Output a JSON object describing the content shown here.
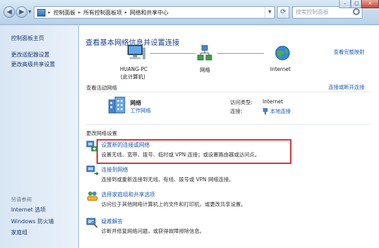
{
  "address_bar": {
    "breadcrumbs": [
      "控制面板",
      "所有控制面板项",
      "网络和共享中心"
    ],
    "search_placeholder": "搜索控制面板"
  },
  "sidebar": {
    "home": "控制面板主页",
    "links": [
      "更改适配器设置",
      "更改高级共享设置"
    ],
    "see_also_heading": "另请参阅",
    "see_also": [
      "Internet 选项",
      "Windows 防火墙",
      "家庭组"
    ]
  },
  "main": {
    "title": "查看基本网络信息并设置连接",
    "view_full_map": "查看完整映射",
    "map": {
      "computer": "HUANG-PC",
      "computer_sub": "(此计算机)",
      "network": "网络",
      "internet": "Internet"
    },
    "active_heading": "查看活动网络",
    "connect_disconnect": "连接或断开连接",
    "active_network": {
      "name": "网络",
      "type": "工作网络",
      "access_type_label": "访问类型:",
      "access_type_value": "Internet",
      "connection_label": "连接:",
      "connection_value": "本地连接"
    },
    "change_heading": "更改网络设置",
    "tasks": [
      {
        "title": "设置新的连接或网络",
        "desc": "设置无线、宽带、拨号、临时或 VPN 连接；或设置路由器或访问点。"
      },
      {
        "title": "连接到网络",
        "desc": "连接到或重新连接到无线、有线、拨号或 VPN 网络连接。"
      },
      {
        "title": "选择家庭组和共享选项",
        "desc": "访问位于其他网络计算机上的文件和打印机，或更改共享设置。"
      },
      {
        "title": "疑难解答",
        "desc": "诊断并修复网络问题，或获得故障排除信息。"
      }
    ]
  },
  "colors": {
    "link": "#1d5bb8",
    "title": "#1b3f8b",
    "highlight_border": "#d0363a",
    "sidebar_bg": "#dfeaf6"
  }
}
